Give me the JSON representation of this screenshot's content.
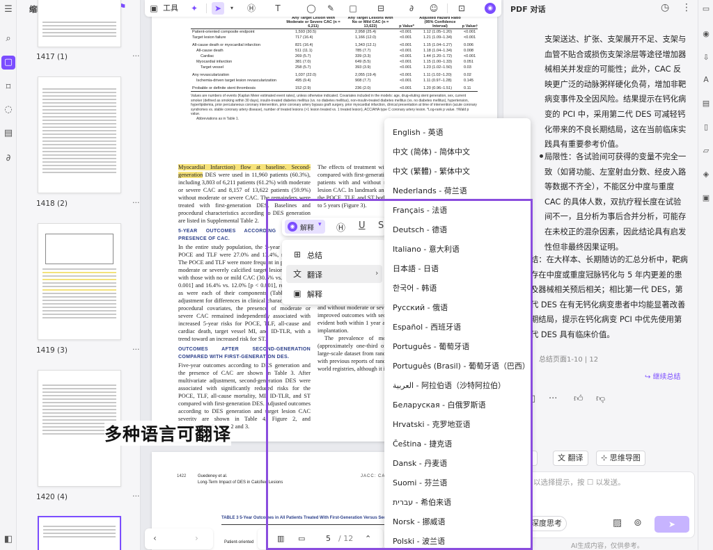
{
  "toolbar": {
    "tools_label": "工具",
    "pdf_dialog_title": "PDF 对话"
  },
  "thumbnails": {
    "title": "缩略图",
    "pages": [
      {
        "label": "1417 (1)"
      },
      {
        "label": "1418 (2)"
      },
      {
        "label": "1419 (3)"
      },
      {
        "label": "1420 (4)"
      }
    ]
  },
  "table": {
    "col_headers": [
      "Any Target Lesion With Moderate or Severe CAC (n = 6,211)",
      "Any Target Lesions With No or Mild CAC (n = 13,622)",
      "p Value*",
      "Adjusted Hazard Ratio (95% Confidence Interval)",
      "p Value†"
    ],
    "rows": [
      {
        "label": "Patient-oriented composite endpoint",
        "a": "1,593 (30.5)",
        "b": "2,958 (25.4)",
        "p": "<0.001",
        "hr": "1.12 (1.05–1.20)",
        "p2": "<0.001",
        "indent": 0
      },
      {
        "label": "Target lesion failure",
        "a": "717 (16.4)",
        "b": "1,166 (12.0)",
        "p": "<0.001",
        "hr": "1.21 (1.09–1.34)",
        "p2": "<0.001",
        "indent": 0,
        "gap": true
      },
      {
        "label": "All-cause death or myocardial infarction",
        "a": "821 (16.4)",
        "b": "1,343 (12.1)",
        "p": "<0.001",
        "hr": "1.15 (1.04–1.27)",
        "p2": "0.006",
        "indent": 0
      },
      {
        "label": "All-cause death",
        "a": "511 (11.1)",
        "b": "785 (7.7)",
        "p": "<0.001",
        "hr": "1.18 (1.04–1.34)",
        "p2": "0.008",
        "indent": 1
      },
      {
        "label": "Cardiac",
        "a": "269 (5.7)",
        "b": "339 (3.3)",
        "p": "<0.001",
        "hr": "1.44 (1.20–1.72)",
        "p2": "<0.001",
        "indent": 2
      },
      {
        "label": "Myocardial infarction",
        "a": "381 (7.0)",
        "b": "649 (5.5)",
        "p": "<0.001",
        "hr": "1.15 (1.00–1.33)",
        "p2": "0.051",
        "indent": 1
      },
      {
        "label": "Target vessel",
        "a": "258 (5.7)",
        "b": "393 (3.9)",
        "p": "<0.001",
        "hr": "1.23 (1.02–1.50)",
        "p2": "0.03",
        "indent": 2,
        "gap": true
      },
      {
        "label": "Any revascularization",
        "a": "1,037 (22.0)",
        "b": "2,055 (19.4)",
        "p": "<0.001",
        "hr": "1.11 (1.02–1.20)",
        "p2": "0.02",
        "indent": 0
      },
      {
        "label": "Ischemia-driven target lesion revascularization",
        "a": "495 (9.4)",
        "b": "908 (7.7)",
        "p": "<0.001",
        "hr": "1.11 (0.97–1.28)",
        "p2": "0.145",
        "indent": 1,
        "gap": true
      },
      {
        "label": "Probable or definite stent thrombosis",
        "a": "152 (2.9)",
        "b": "236 (2.0)",
        "p": "<0.001",
        "hr": "1.20 (0.96–1.51)",
        "p2": "0.11",
        "indent": 0
      }
    ],
    "footnote": "Values are numbers of events (Kaplan Meier estimated event rates), unless otherwise indicated. Covariates included in the models: age, drug-eluting stent generation, sex, current smoker (defined as smoking within 30 days), insulin-treated diabetes mellitus (vs. no diabetes mellitus), non-insulin-treated diabetes mellitus (vs. no diabetes mellitus), hypertension, hyperlipidemia, prior percutaneous coronary intervention, prior coronary artery bypass graft surgery, prior myocardial infarction, clinical presentation at time of intervention (acute coronary syndromes vs. stable coronary artery disease), number of treated lesions (>1 lesion treated vs. 1 treated lesion), ACC/AHA type C coronary artery lesion. *Log-rank p value. †Wald p value.",
    "abbrev": "Abbreviations as in Table 1."
  },
  "article": {
    "left_para1_hl": "Myocardial Infarction) flow at baseline. Second-generation",
    "left_para1": " DES were used in 11,960 patients (60.3%), including 3,803 of 6,211 patients (61.2%) with moderate or severe CAC and 8,157 of 13,622 patients (59.9%) without moderate or severe CAC. The remainders were treated with first-generation DES. Baselines and procedural characteristics according to DES generation are listed in Supplemental Table 2.",
    "heading1": "5-YEAR OUTCOMES ACCORDING TO THE PRESENCE OF CAC.",
    "left_para2": " In the entire study population, the 5-year rates of the POCE and TLF were 27.0% and 13.4%, respectively. The POCE and TLF were more frequent in patients with moderate or severely calcified target lesions compared with those with no or mild CAC (30.5% vs. 25.4% [p < 0.001] and 16.4% vs. 12.0% [p < 0.001], respectively), as were each of their components (Table 2). After adjustment for differences in clinical characteristics and procedural covariates, the presence of moderate or severe CAC remained independently associated with increased 5-year risks for POCE, TLF, all-cause and cardiac death, target vessel MI, and ID-TLR, with a trend toward an increased risk for ST.",
    "heading2": "OUTCOMES AFTER SECOND-GENERATION COMPARED WITH FIRST-GENERATION DES.",
    "left_para3": " Five-year outcomes according to DES generation and the presence of CAC are shown in Table 3. After multivariate adjustment, second-generation DES were associated with significantly reduced risks for the POCE, TLF, all-cause mortality, MI, ID-TLR, and ST compared with first-generation DES. Adjusted outcomes according to DES generation and target lesion CAC severity are shown in Table 4, Figure 2, and Supplemental Figures 2 and 3.",
    "right_para1": "The effects of treatment with second-generation DES compared with first-generation DES were consistent in patients with and without moderate or severe target lesion CAC. In landmark analyses, the relative risks of the POCE, TLF, and ST both within 1 year and from 1 to 5 years (Figure 3).",
    "right_para2": "with second-generation DES were associated with significant reductions in the POCE and its components: TLF, death, MI, ID-TLR, and ST. The benefit of second-generation DES was consistent in patients with and without moderate or severe target lesion CAC. The improved outcomes with second-generation DES were evident both within 1 year and from 1 to 5 years after implantation.",
    "right_para3": "The prevalence of moderate or severe CAC (approximately one-third of patients) in the present large-scale dataset from randomized trials is consistent with previous reports of randomized trials (1) and real-world registries, although it is higher than that reported"
  },
  "page2": {
    "page_num": "1422",
    "author": "Guedeney et al.",
    "title": "Long-Term Impact of DES in Calcified Lesions",
    "journal": "JACC: CARDIOVASCULAR INTERVENTIONS",
    "table_title": "TABLE 3  5-Year Outcomes in All Patients Treated With First-Generation Versus Second-Generation DES",
    "row_label": "Patient-oriented"
  },
  "overlay_caption": "多种语言可翻译",
  "selection_toolbar": {
    "ai_label": "解释"
  },
  "ai_menu": {
    "items": [
      {
        "label": "总结",
        "icon": "summary-icon"
      },
      {
        "label": "翻译",
        "icon": "translate-icon"
      },
      {
        "label": "解释",
        "icon": "explain-icon"
      }
    ]
  },
  "languages": [
    "English - 英语",
    "中文 (简体) - 简体中文",
    "中文 (繁體) - 繁体中文",
    "Nederlands - 荷兰语",
    "Français - 法语",
    "Deutsch - 德语",
    "Italiano - 意大利语",
    "日本語 - 日语",
    "한국어 - 韩语",
    "Русский - 俄语",
    "Español - 西班牙语",
    "Português - 葡萄牙语",
    "Português (Brasil) - 葡萄牙语（巴西）",
    "العربية - 阿拉伯语（沙特阿拉伯）",
    "Беларуская - 白俄罗斯语",
    "Hrvatski - 克罗地亚语",
    "Čeština - 捷克语",
    "Dansk - 丹麦语",
    "Suomi - 芬兰语",
    "עברית - 希伯来语",
    "Norsk - 挪威语",
    "Polski - 波兰语"
  ],
  "page_nav": {
    "current_page": "5",
    "total_pages": "/ 12"
  },
  "right_panel": {
    "text_lines": [
      "支架送达、扩张、支架展开不足、支架与",
      "血管不贴合或损伤支架涂层等途径增加器",
      "械相关并发症的可能性；此外，CAC 反",
      "映更广泛的动脉粥样硬化负荷，增加非靶",
      "病变事件及全因风险。结果提示在钙化病",
      "变的 PCI 中，采用第二代 DES 可减轻钙",
      "化带来的不良长期结局，这在当前临床实",
      "践具有重要参考价值。"
    ],
    "bullet_lines": [
      "局限性：各试验间可获得的变量不完全一",
      "致（如肾功能、左室射血分数、经皮入路",
      "等数据不齐全），不能区分中度与重度",
      "CAC 的具体人数，双抗疗程长度在试验",
      "间不一，且分析为事后合并分析，可能存",
      "在未校正的混杂因素，因此结论具有启发",
      "性但非最终因果证明。"
    ],
    "partial_lines": [
      "结：在大样本、长期随访的汇总分析中，靶病",
      "存在中度或重度冠脉钙化与 5 年内更差的患",
      "及器械相关预后相关；相比第一代 DES，第",
      "代 DES 在有无钙化病变患者中均能显著改善",
      "期结局，提示在钙化病变 PCI 中优先使用第",
      "代 DES 具有临床价值。"
    ],
    "summary_pages": "总结页面1-10 | 12",
    "continue_label": "继续总结",
    "actions": [
      "结",
      "翻译",
      "思维导图"
    ],
    "input_placeholder": "以选择提示，按 ☐ 以发送。",
    "deep_think": "深度思考",
    "disclaimer": "AI生成内容，仅供参考。"
  }
}
